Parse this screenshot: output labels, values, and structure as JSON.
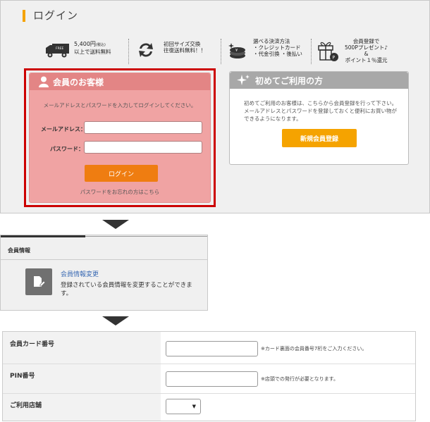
{
  "login_page": {
    "title": "ログイン",
    "features": [
      {
        "icon": "truck-icon",
        "badge": "FREE",
        "line1": "5,400円",
        "line1_small": "(税込)",
        "line2": "以上で送料無料"
      },
      {
        "icon": "exchange-arrows-icon",
        "line1": "初回サイズ交換",
        "line2": "往復送料無料！！"
      },
      {
        "icon": "coins-icon",
        "line1": "選べる決済方法",
        "line2": "・クレジットカード",
        "line3": "・代金引換 ・後払い"
      },
      {
        "icon": "gift-icon",
        "line1": "会員登録で",
        "line2": "500Pプレゼント♪",
        "line3": "&",
        "line4": "ポイント１％還元"
      }
    ],
    "member": {
      "heading": "会員のお客様",
      "description": "メールアドレスとパスワードを入力してログインしてください。",
      "email_label": "メールアドレス：",
      "email_value": "",
      "password_label": "パスワード：",
      "password_value": "",
      "login_button": "ログイン",
      "forgot_link": "パスワードをお忘れの方はこちら"
    },
    "new_user": {
      "heading": "初めてご利用の方",
      "description": "初めてご利用のお客様は、こちらから会員登録を行って下さい。メールアドレスとパスワードを登録しておくと便利にお買い物ができるようになります。",
      "register_button": "新規会員登録"
    }
  },
  "member_info": {
    "title": "会員情報",
    "link": "会員情報変更",
    "description": "登録されている会員情報を変更することができます。"
  },
  "card_form": {
    "rows": [
      {
        "label": "会員カード番号",
        "value": "",
        "note": "※カード裏面の会員番号7桁をご入力ください。"
      },
      {
        "label": "PIN番号",
        "value": "",
        "note": "※店頭での発行が必要となります。"
      },
      {
        "label": "ご利用店舗",
        "selected": ""
      }
    ]
  },
  "colors": {
    "accent_orange": "#ef7d11",
    "accent_yellow": "#f5a300",
    "highlight_red": "#cc0000",
    "member_pink": "#f0a3a3",
    "link_blue": "#3a6ab3"
  }
}
